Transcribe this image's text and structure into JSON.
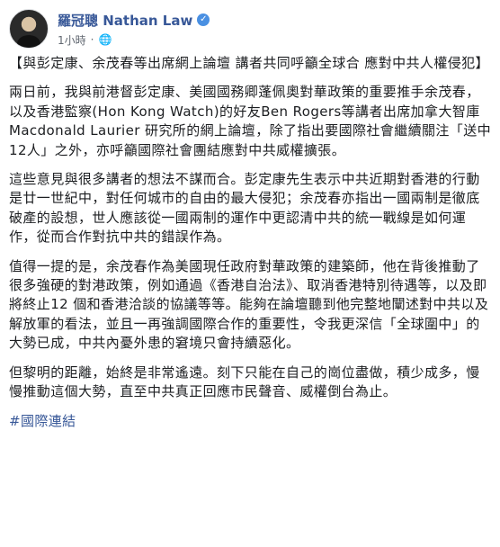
{
  "author": {
    "name": "羅冠聰 Nathan Law",
    "time": "1小時",
    "separator": "·"
  },
  "icons": {
    "verified": "verified-badge-icon",
    "audience": "globe-icon"
  },
  "post": {
    "title": "【與彭定康、余茂春等出席網上論壇 講者共同呼籲全球合 應對中共人權侵犯】",
    "paragraphs": [
      "兩日前，我與前港督彭定康、美國國務卿蓬佩奧對華政策的重要推手余茂春，以及香港監察(Hon Kong Watch)的好友Ben Rogers等講者出席加拿大智庫 Macdonald Laurier 研究所的網上論壇，除了指出要國際社會繼續關注「送中12人」之外，亦呼籲國際社會團結應對中共威權擴張。",
      "這些意見與很多講者的想法不謀而合。彭定康先生表示中共近期對香港的行動是廿一世紀中，對任何城市的自由的最大侵犯；余茂春亦指出一國兩制是徹底破產的設想，世人應該從一國兩制的運作中更認清中共的統一戰線是如何運作，從而合作對抗中共的錯誤作為。",
      "值得一提的是，余茂春作為美國現任政府對華政策的建築師，他在背後推動了很多強硬的對港政策，例如通過《香港自治法》、取消香港特別待遇等，以及即將終止12 個和香港洽談的協議等等。能夠在論壇聽到他完整地闡述對中共以及解放軍的看法，並且一再強調國際合作的重要性，令我更深信「全球圍中」的大勢已成，中共內憂外患的窘境只會持續惡化。",
      "但黎明的距離，始終是非常遙遠。刻下只能在自己的崗位盡做，積少成多，慢慢推動這個大勢，直至中共真正回應市民聲音、威權倒台為止。"
    ],
    "hashtag": "#國際連結"
  }
}
